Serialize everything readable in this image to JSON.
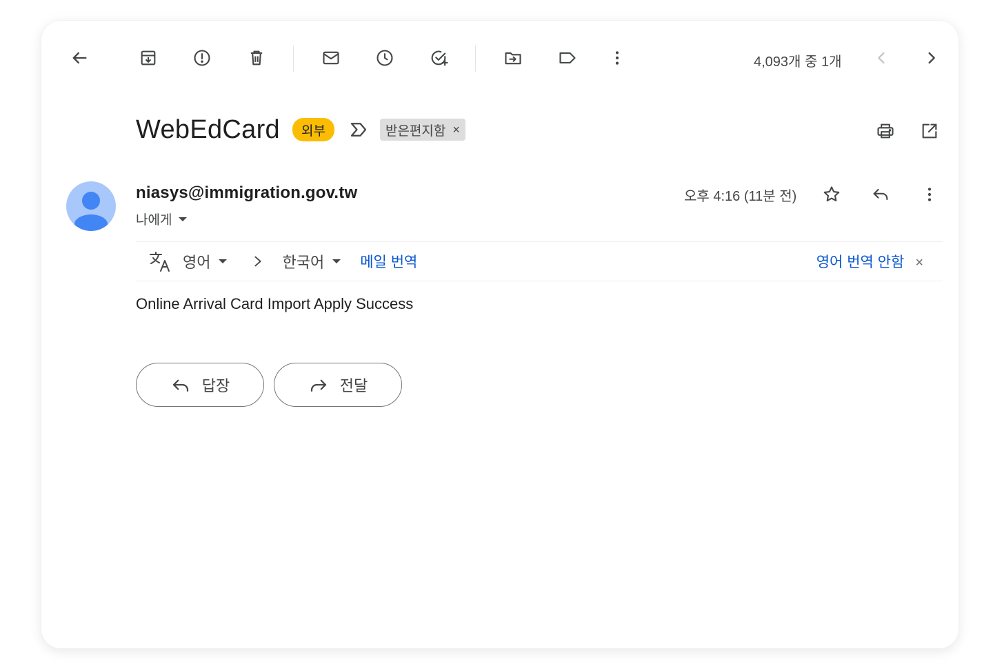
{
  "toolbar": {
    "icons": [
      "back-arrow-icon",
      "archive-icon",
      "report-spam-icon",
      "delete-icon",
      "mark-unread-icon",
      "snooze-icon",
      "add-task-icon",
      "move-to-icon",
      "label-icon",
      "more-vert-icon"
    ],
    "pager": "4,093개 중 1개"
  },
  "email": {
    "subject": "WebEdCard",
    "external_badge": "외부",
    "label_chip": "받은편지함",
    "label_chip_close": "×",
    "sender": "niasys@immigration.gov.tw",
    "recipient": "나에게",
    "time": "오후 4:16 (11분 전)",
    "body": "Online Arrival Card Import Apply Success"
  },
  "translate": {
    "from_lang": "영어",
    "to_lang": "한국어",
    "translate_link": "메일 번역",
    "never_translate": "영어 번역 안함",
    "close": "×"
  },
  "actions": {
    "reply": "답장",
    "forward": "전달"
  },
  "colors": {
    "accent_blue": "#0b57d0",
    "badge_yellow": "#fbbc04",
    "avatar_bg": "#a8c7fa",
    "avatar_fg": "#4285f4"
  }
}
